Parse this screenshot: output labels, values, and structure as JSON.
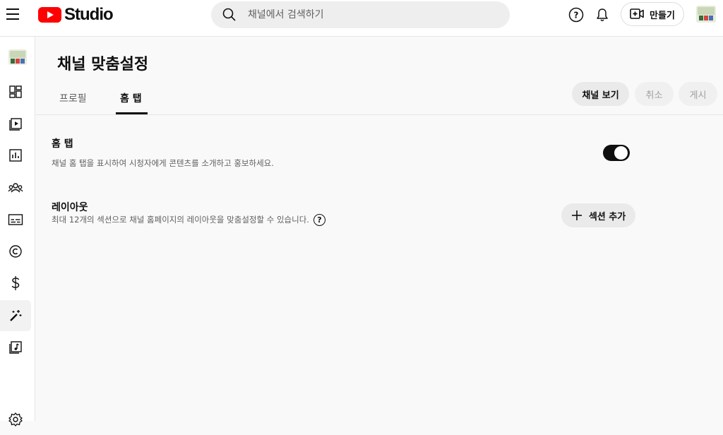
{
  "header": {
    "logo_text": "Studio",
    "search_placeholder": "채널에서 검색하기",
    "create_label": "만들기",
    "help_glyph": "?"
  },
  "page": {
    "title": "채널 맞춤설정",
    "tabs": [
      {
        "label": "프로필",
        "active": false
      },
      {
        "label": "홈 탭",
        "active": true
      }
    ],
    "actions": {
      "view_channel": "채널 보기",
      "cancel": "취소",
      "publish": "게시"
    }
  },
  "sections": {
    "home_tab": {
      "title": "홈 탭",
      "description": "채널 홈 탭을 표시하여 시청자에게 콘텐츠를 소개하고 홍보하세요.",
      "enabled": true
    },
    "layout": {
      "title": "레이아웃",
      "description": "최대 12개의 섹션으로 채널 홈페이지의 레이아웃을 맞춤설정할 수 있습니다.",
      "help_glyph": "?",
      "add_section_label": "섹션 추가"
    }
  },
  "sidebar": {
    "items": [
      {
        "icon": "channel-avatar-icon"
      },
      {
        "icon": "dashboard-icon"
      },
      {
        "icon": "content-icon"
      },
      {
        "icon": "analytics-icon"
      },
      {
        "icon": "community-icon"
      },
      {
        "icon": "subtitles-icon"
      },
      {
        "icon": "copyright-icon"
      },
      {
        "icon": "earn-icon"
      },
      {
        "icon": "customization-icon",
        "active": true
      },
      {
        "icon": "audio-library-icon"
      },
      {
        "icon": "settings-icon"
      }
    ]
  },
  "colors": {
    "brand_red": "#ff0000",
    "text_primary": "#0f0f0f",
    "text_secondary": "#606060"
  }
}
